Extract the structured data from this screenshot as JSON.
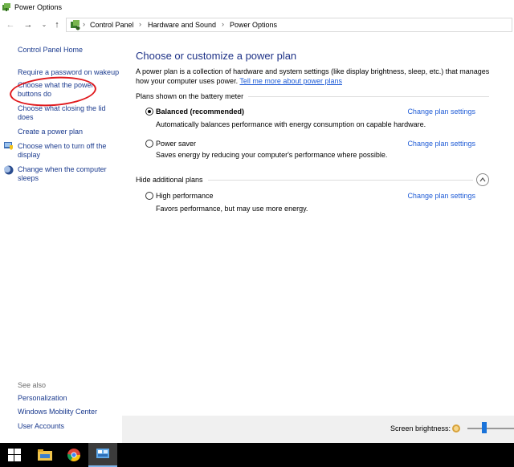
{
  "window": {
    "title": "Power Options"
  },
  "address": {
    "crumbs": [
      "Control Panel",
      "Hardware and Sound",
      "Power Options"
    ]
  },
  "sidebar": {
    "home": "Control Panel Home",
    "links": [
      "Require a password on wakeup",
      "Choose what the power buttons do",
      "Choose what closing the lid does",
      "Create a power plan",
      "Choose when to turn off the display",
      "Change when the computer sleeps"
    ],
    "see_also_label": "See also",
    "see_also": [
      "Personalization",
      "Windows Mobility Center",
      "User Accounts"
    ]
  },
  "main": {
    "title": "Choose or customize a power plan",
    "description": "A power plan is a collection of hardware and system settings (like display brightness, sleep, etc.) that manages how your computer uses power.",
    "tell_more": "Tell me more about power plans",
    "section_battery": "Plans shown on the battery meter",
    "section_hidden": "Hide additional plans",
    "change_label": "Change plan settings",
    "plans": [
      {
        "name": "Balanced (recommended)",
        "desc": "Automatically balances performance with energy consumption on capable hardware.",
        "selected": true
      },
      {
        "name": "Power saver",
        "desc": "Saves energy by reducing your computer's performance where possible.",
        "selected": false
      },
      {
        "name": "High performance",
        "desc": "Favors performance, but may use more energy.",
        "selected": false
      }
    ]
  },
  "footer": {
    "brightness_label": "Screen brightness:"
  },
  "colors": {
    "link": "#1e5bd6",
    "title": "#1e3287",
    "annotation": "#e0191d"
  }
}
